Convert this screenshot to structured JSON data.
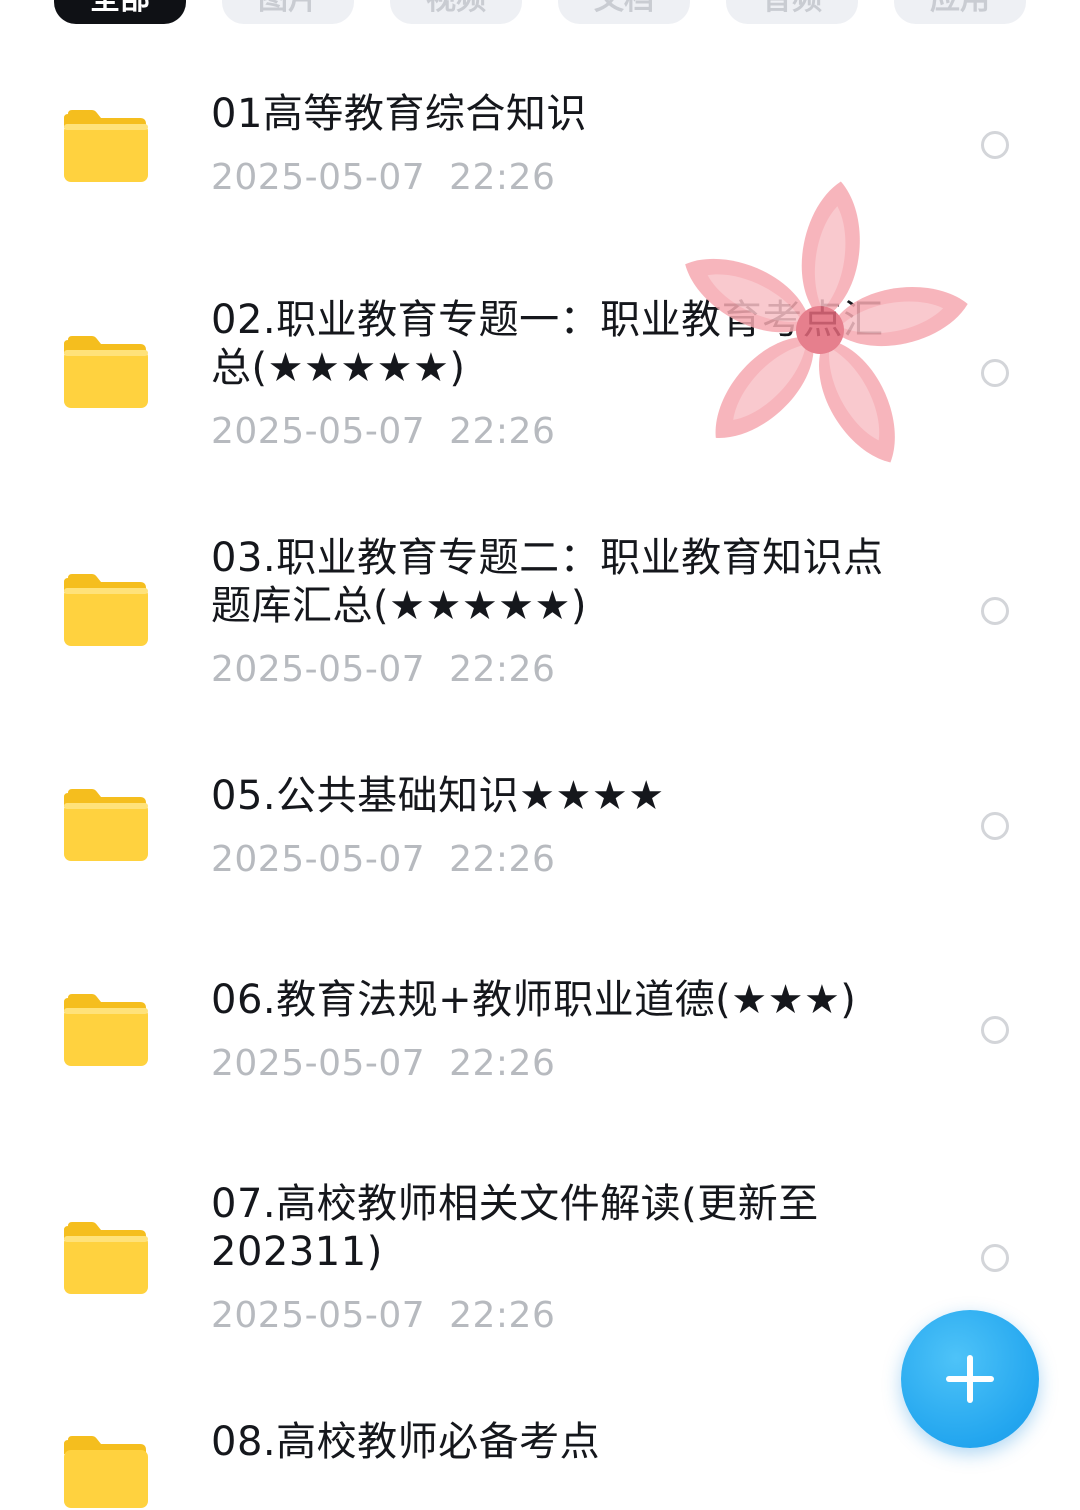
{
  "tabs": [
    {
      "label": "全部",
      "active": true
    },
    {
      "label": "图片",
      "active": false
    },
    {
      "label": "视频",
      "active": false
    },
    {
      "label": "文档",
      "active": false
    },
    {
      "label": "音频",
      "active": false
    },
    {
      "label": "应用",
      "active": false
    }
  ],
  "files": [
    {
      "title": "01高等教育综合知识",
      "date": "2025-05-07  22:26"
    },
    {
      "title": "02.职业教育专题一：职业教育考点汇总(★★★★★)",
      "date": "2025-05-07  22:26"
    },
    {
      "title": "03.职业教育专题二：职业教育知识点题库汇总(★★★★★)",
      "date": "2025-05-07  22:26"
    },
    {
      "title": "05.公共基础知识★★★★",
      "date": "2025-05-07  22:26"
    },
    {
      "title": "06.教育法规+教师职业道德(★★★)",
      "date": "2025-05-07  22:26"
    },
    {
      "title": "07.高校教师相关文件解读(更新至202311)",
      "date": "2025-05-07  22:26"
    },
    {
      "title": "08.高校教师必备考点",
      "date": ""
    }
  ],
  "icons": {
    "file": "folder-icon",
    "select": "radio-circle-icon",
    "fab": "plus-icon",
    "sticker": "flower-sticker-icon"
  },
  "colors": {
    "folder": "#FFD23F",
    "fab": "#23A6EF",
    "tab_active_bg": "#0F1115",
    "date_text": "#B7BABF"
  }
}
